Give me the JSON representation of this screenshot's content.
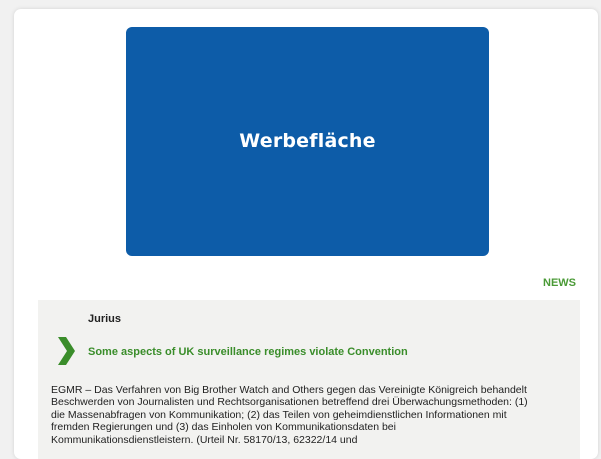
{
  "ad": {
    "label": "Werbefläche",
    "background": "#0d5ca8"
  },
  "section": {
    "label": "NEWS",
    "color": "#4a9a36"
  },
  "news": {
    "source": "Jurius",
    "title": "Some aspects of UK surveillance regimes violate Convention",
    "title_color": "#3a8d2a",
    "icon": "chevron-right-icon",
    "body": "EGMR – Das Verfahren von Big Brother Watch and Others gegen das Vereinigte Königreich behandelt Beschwerden von Journalisten und Rechtsorganisationen betreffend drei Überwachungsmethoden: (1) die Massenabfragen von Kommunikation; (2) das Teilen von geheimdienstlichen Informationen mit fremden Regierungen und (3) das Einholen von Kommunikationsdaten bei Kommunikationsdienstleistern. (Urteil Nr. 58170/13, 62322/14 und"
  }
}
